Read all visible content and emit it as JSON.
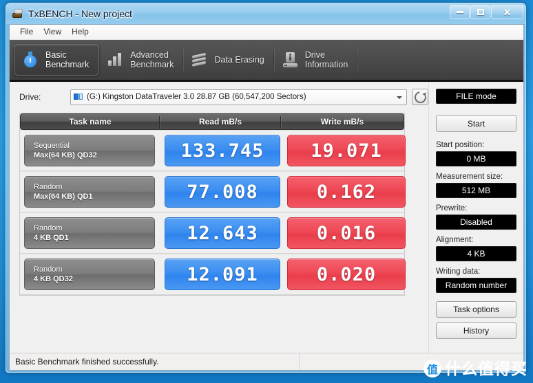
{
  "window": {
    "title": "TxBENCH - New project",
    "app_icon": "disk-cloud-icon",
    "minimize_label": "Minimize",
    "maximize_label": "Maximize",
    "close_label": "Close"
  },
  "menubar": {
    "items": [
      {
        "label": "File"
      },
      {
        "label": "View"
      },
      {
        "label": "Help"
      }
    ]
  },
  "tabs": [
    {
      "label": "Basic\nBenchmark",
      "icon": "stopwatch-icon",
      "active": true
    },
    {
      "label": "Advanced\nBenchmark",
      "icon": "bar-chart-icon",
      "active": false
    },
    {
      "label": "Data Erasing",
      "icon": "erase-icon",
      "active": false
    },
    {
      "label": "Drive\nInformation",
      "icon": "drive-info-icon",
      "active": false
    }
  ],
  "drive": {
    "label": "Drive:",
    "selected": "(G:) Kingston DataTraveler 3.0  28.87 GB (60,547,200 Sectors)",
    "icon": "drive-icon",
    "refresh_icon": "refresh-icon"
  },
  "table": {
    "headers": [
      "Task name",
      "Read mB/s",
      "Write mB/s"
    ],
    "rows": [
      {
        "task_line1": "Sequential",
        "task_line2": "Max(64 KB) QD32",
        "read": "133.745",
        "write": "19.071"
      },
      {
        "task_line1": "Random",
        "task_line2": "Max(64 KB) QD1",
        "read": "77.008",
        "write": "0.162"
      },
      {
        "task_line1": "Random",
        "task_line2": "4 KB QD1",
        "read": "12.643",
        "write": "0.016"
      },
      {
        "task_line1": "Random",
        "task_line2": "4 KB QD32",
        "read": "12.091",
        "write": "0.020"
      }
    ]
  },
  "sidebar": {
    "mode": "FILE mode",
    "start_button": "Start",
    "fields": [
      {
        "label": "Start position:",
        "value": "0 MB"
      },
      {
        "label": "Measurement size:",
        "value": "512 MB"
      },
      {
        "label": "Prewrite:",
        "value": "Disabled"
      },
      {
        "label": "Alignment:",
        "value": "4 KB"
      },
      {
        "label": "Writing data:",
        "value": "Random number"
      }
    ],
    "task_options_button": "Task options",
    "history_button": "History"
  },
  "status": {
    "message": "Basic Benchmark finished successfully."
  },
  "watermark": {
    "logo": "值",
    "text": "什么值得买"
  },
  "colors": {
    "read_accent": "#3b8ef0",
    "write_accent": "#ef4855",
    "tab_active_accent": "#2f8ae0",
    "dark_panel": "#4b4b4b"
  }
}
